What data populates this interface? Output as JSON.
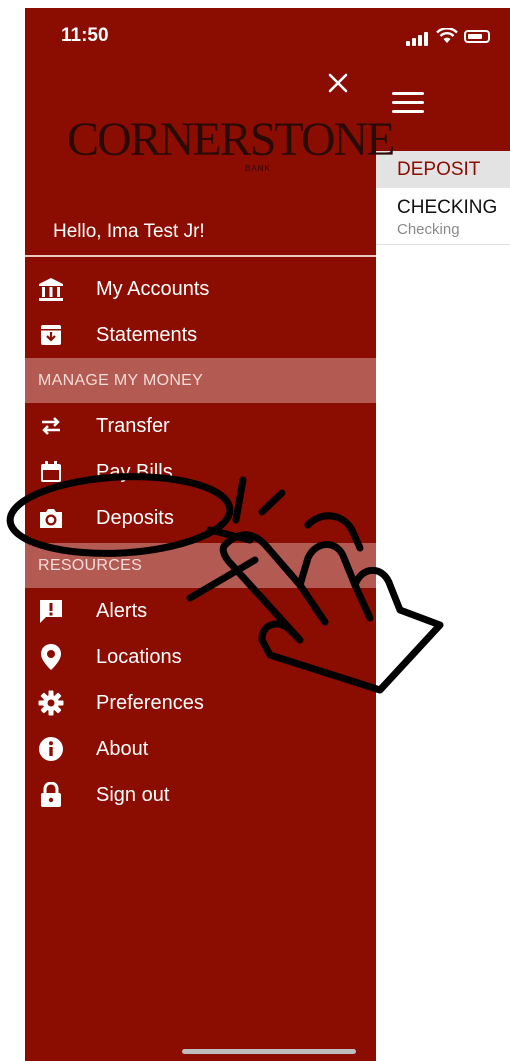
{
  "status_bar": {
    "time": "11:50"
  },
  "drawer": {
    "brand": {
      "name": "CORNERSTONE",
      "sub": "BANK"
    },
    "greeting": "Hello, Ima Test Jr!",
    "items_top": [
      {
        "label": "My Accounts",
        "icon": "bank-icon"
      },
      {
        "label": "Statements",
        "icon": "statement-download-icon"
      }
    ],
    "section_manage": "MANAGE MY MONEY",
    "items_manage": [
      {
        "label": "Transfer",
        "icon": "transfer-arrows-icon"
      },
      {
        "label": "Pay Bills",
        "icon": "calendar-icon"
      },
      {
        "label": "Deposits",
        "icon": "camera-icon"
      }
    ],
    "section_resources": "RESOURCES",
    "items_resources": [
      {
        "label": "Alerts",
        "icon": "alert-message-icon"
      },
      {
        "label": "Locations",
        "icon": "location-pin-icon"
      },
      {
        "label": "Preferences",
        "icon": "gear-icon"
      },
      {
        "label": "About",
        "icon": "info-icon"
      },
      {
        "label": "Sign out",
        "icon": "lock-icon"
      }
    ]
  },
  "content": {
    "header": "DEPOSIT",
    "account_name": "CHECKING",
    "account_type": "Checking"
  },
  "colors": {
    "brand_red": "#8b0d02",
    "section_bg": "#b35a52",
    "content_bg": "#ffffff"
  }
}
